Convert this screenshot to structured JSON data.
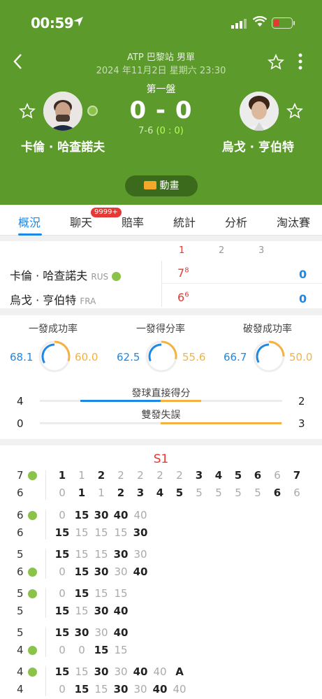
{
  "status_bar": {
    "time": "00:59"
  },
  "header": {
    "tournament": "ATP 巴黎站 男單",
    "datetime": "2024 年11月2日 星期六 23:30",
    "set_label": "第一盤",
    "score": "0 - 0",
    "set_score_prefix": "7-6",
    "set_score_paren": "(0 : 0)",
    "player1": "卡倫 · 哈查諾夫",
    "player2": "烏戈 · 亨伯特",
    "animation_label": "動畫"
  },
  "tabs": [
    {
      "label": "概況",
      "active": true
    },
    {
      "label": "聊天",
      "active": false
    },
    {
      "label": "賠率",
      "active": false
    },
    {
      "label": "統計",
      "active": false
    },
    {
      "label": "分析",
      "active": false
    },
    {
      "label": "淘汰賽",
      "active": false
    }
  ],
  "chat_badge": "9999+",
  "scoreboard": {
    "set_headers": [
      "1",
      "2",
      "3"
    ],
    "rows": [
      {
        "name": "卡倫 · 哈查諾夫",
        "country": "RUS",
        "set1": "7",
        "tb": "8",
        "total": "0"
      },
      {
        "name": "烏戈 · 亨伯特",
        "country": "FRA",
        "set1": "6",
        "tb": "6",
        "total": "0"
      }
    ]
  },
  "stats": {
    "rings": [
      {
        "label": "一發成功率",
        "left": "68.1",
        "right": "60.0",
        "left_frac": 0.681,
        "right_frac": 0.6
      },
      {
        "label": "一發得分率",
        "left": "62.5",
        "right": "55.6",
        "left_frac": 0.625,
        "right_frac": 0.556
      },
      {
        "label": "破發成功率",
        "left": "66.7",
        "right": "50.0",
        "left_frac": 0.667,
        "right_frac": 0.5
      }
    ],
    "bars": [
      {
        "label": "發球直接得分",
        "left": "4",
        "right": "2"
      },
      {
        "label": "雙發失誤",
        "left": "0",
        "right": "3"
      }
    ]
  },
  "point_by_point": {
    "set_label": "S1",
    "games_summary": {
      "top_label": "7",
      "bottom_label": "6",
      "top": [
        "1",
        "1",
        "2",
        "2",
        "2",
        "2",
        "2",
        "3",
        "4",
        "5",
        "6",
        "6",
        "7"
      ],
      "bottom": [
        "0",
        "1",
        "1",
        "2",
        "3",
        "4",
        "5",
        "5",
        "5",
        "5",
        "5",
        "6",
        "6"
      ]
    },
    "games": [
      {
        "top_label": "6",
        "bottom_label": "6",
        "server": "top",
        "top": [
          "0",
          "15",
          "30",
          "40",
          "40"
        ],
        "bottom": [
          "15",
          "15",
          "15",
          "15",
          "30"
        ]
      },
      {
        "top_label": "5",
        "bottom_label": "6",
        "server": "bottom",
        "top": [
          "15",
          "15",
          "15",
          "30",
          "30"
        ],
        "bottom": [
          "0",
          "15",
          "30",
          "30",
          "40"
        ]
      },
      {
        "top_label": "5",
        "bottom_label": "5",
        "server": "top",
        "top": [
          "0",
          "15",
          "15",
          "15"
        ],
        "bottom": [
          "15",
          "15",
          "30",
          "40"
        ]
      },
      {
        "top_label": "5",
        "bottom_label": "4",
        "server": "bottom",
        "top": [
          "15",
          "30",
          "30",
          "40"
        ],
        "bottom": [
          "0",
          "0",
          "15",
          "15"
        ]
      },
      {
        "top_label": "4",
        "bottom_label": "4",
        "server": "top",
        "top": [
          "15",
          "15",
          "30",
          "30",
          "40",
          "40",
          "A"
        ],
        "bottom": [
          "0",
          "15",
          "15",
          "30",
          "30",
          "40",
          "40"
        ]
      }
    ]
  },
  "colors": {
    "header_green": "#5b9a2b",
    "accent_blue": "#1e88e5",
    "accent_red": "#e53935",
    "orange": "#f4b245"
  }
}
